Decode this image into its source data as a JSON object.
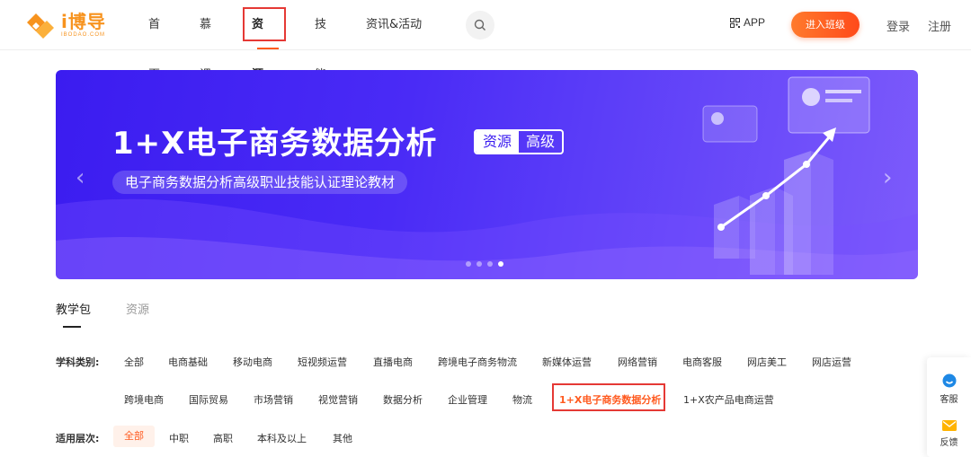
{
  "header": {
    "logo_name": "i博导",
    "logo_sub": "IBODAO.COM",
    "nav": [
      "首页",
      "慕课",
      "资源库",
      "技能",
      "资讯&活动"
    ],
    "active_nav": "资源库",
    "app_label": "APP",
    "enter_button": "进入班级",
    "login": "登录",
    "register": "注册"
  },
  "banner": {
    "title": "1+X电子商务数据分析",
    "tag_1": "资源",
    "tag_2": "高级",
    "subtitle": "电子商务数据分析高级职业技能认证理论教材",
    "slide_count": 4,
    "active_slide": 4
  },
  "tabs": [
    "教学包",
    "资源"
  ],
  "filters": {
    "subject_label": "学科类别:",
    "subjects_row1": [
      "全部",
      "电商基础",
      "移动电商",
      "短视频运营",
      "直播电商",
      "跨境电子商务物流",
      "新媒体运营",
      "网络营销",
      "电商客服",
      "网店美工",
      "网店运营"
    ],
    "subjects_row2": [
      "跨境电商",
      "国际贸易",
      "市场营销",
      "视觉营销",
      "数据分析",
      "企业管理",
      "物流",
      "1+X电子商务数据分析",
      "1+X农产品电商运营"
    ],
    "selected_subject": "1+X电子商务数据分析",
    "level_label": "适用层次:",
    "levels": [
      "全部",
      "中职",
      "高职",
      "本科及以上",
      "其他"
    ],
    "selected_level": "全部"
  },
  "side": {
    "service": "客服",
    "feedback": "反馈"
  },
  "colors": {
    "accent": "#ff5a1f",
    "highlight_box": "#e53935",
    "banner_blue": "#3b1cf0"
  }
}
